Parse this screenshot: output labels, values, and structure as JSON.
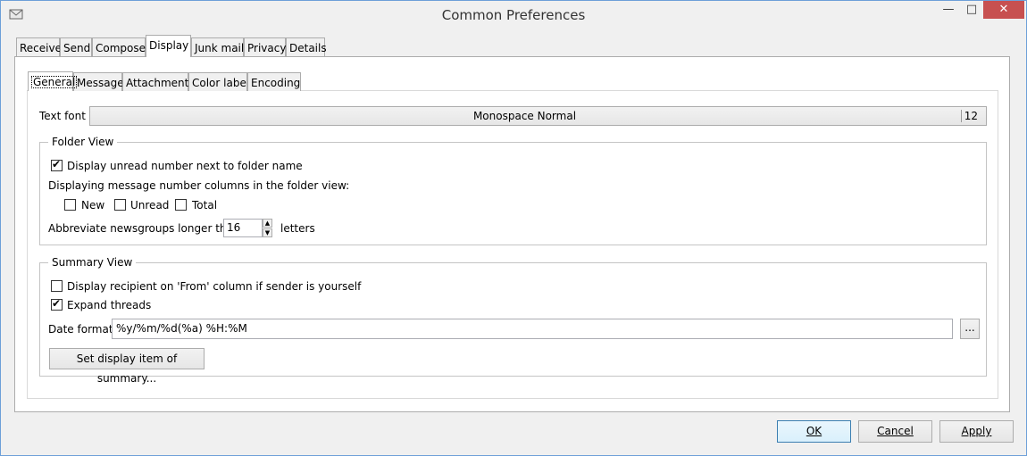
{
  "window": {
    "title": "Common Preferences",
    "minimize": "—",
    "maximize": "□",
    "close": "✕"
  },
  "outer_tabs": [
    "Receive",
    "Send",
    "Compose",
    "Display",
    "Junk mail",
    "Privacy",
    "Details"
  ],
  "outer_active": "Display",
  "inner_tabs": [
    "General",
    "Message",
    "Attachment",
    "Color label",
    "Encoding"
  ],
  "inner_active": "General",
  "general": {
    "text_font_label": "Text font",
    "font_name": "Monospace Normal",
    "font_size": "12"
  },
  "folder_view": {
    "title": "Folder View",
    "unread_next_to_name": {
      "label": "Display unread number next to folder name",
      "checked": true
    },
    "columns_label": "Displaying message number columns in the folder view:",
    "col_new": {
      "label": "New",
      "checked": false
    },
    "col_unread": {
      "label": "Unread",
      "checked": false
    },
    "col_total": {
      "label": "Total",
      "checked": false
    },
    "abbrev_label": "Abbreviate newsgroups longer than",
    "abbrev_value": "16",
    "abbrev_unit": "letters"
  },
  "summary_view": {
    "title": "Summary View",
    "recipient_from": {
      "label": "Display recipient on 'From' column if sender is yourself",
      "checked": false
    },
    "expand_threads": {
      "label": "Expand threads",
      "checked": true
    },
    "date_format_label": "Date format",
    "date_format_value": "%y/%m/%d(%a) %H:%M",
    "dots_label": "...",
    "set_display_label": "Set display item of summary..."
  },
  "buttons": {
    "ok": "OK",
    "cancel": "Cancel",
    "apply": "Apply"
  }
}
